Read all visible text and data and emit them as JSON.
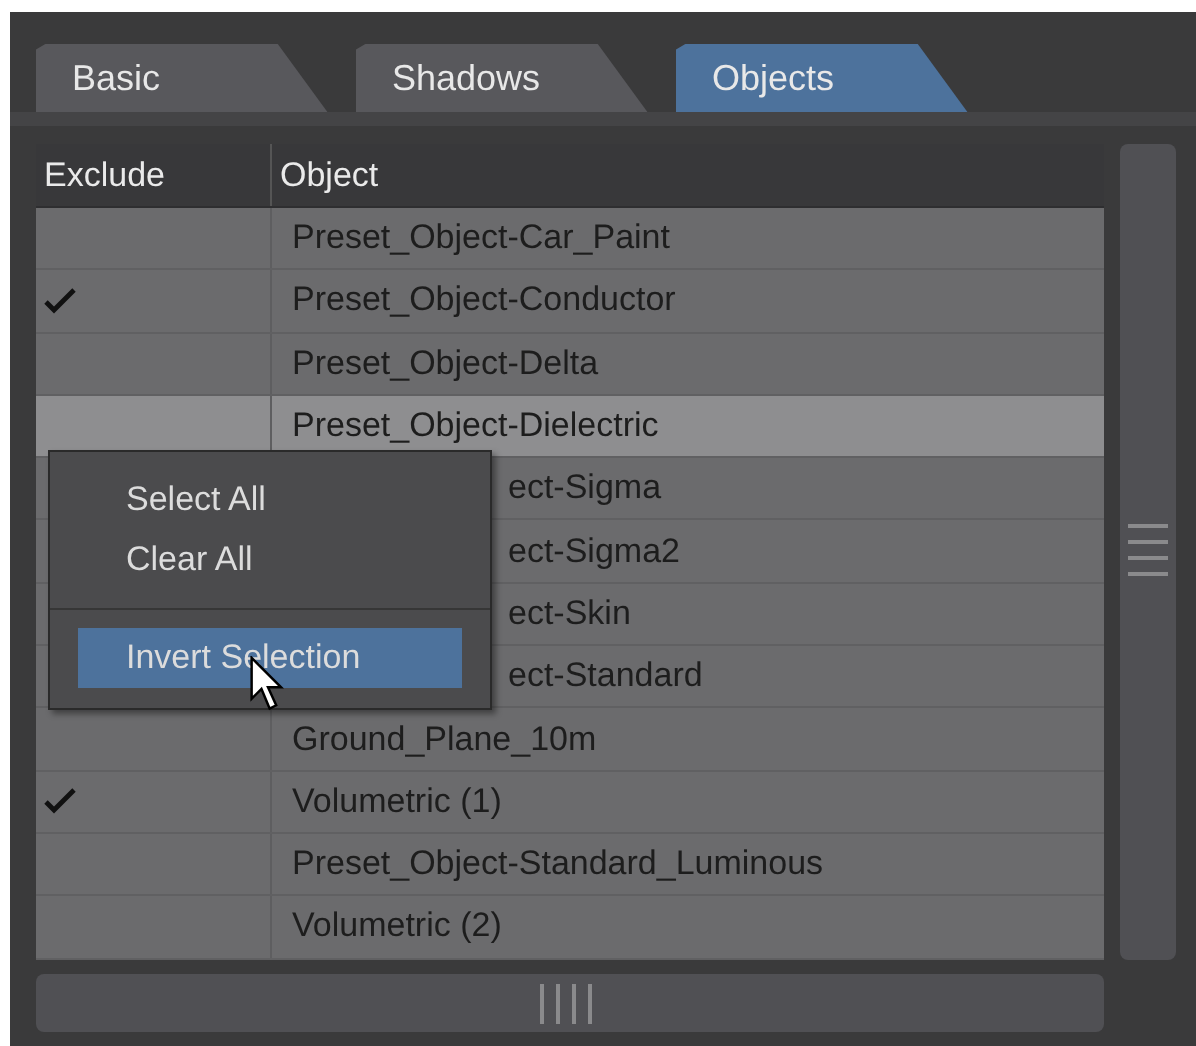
{
  "tabs": [
    {
      "label": "Basic",
      "selected": false
    },
    {
      "label": "Shadows",
      "selected": false
    },
    {
      "label": "Objects",
      "selected": true
    }
  ],
  "table": {
    "columns": [
      "Exclude",
      "Object"
    ],
    "rows": [
      {
        "object": "Preset_Object-Car_Paint",
        "checked": false,
        "selected": false,
        "covered": false
      },
      {
        "object": "Preset_Object-Conductor",
        "checked": true,
        "selected": false,
        "covered": false
      },
      {
        "object": "Preset_Object-Delta",
        "checked": false,
        "selected": false,
        "covered": false
      },
      {
        "object": "Preset_Object-Dielectric",
        "checked": false,
        "selected": true,
        "covered": false
      },
      {
        "object": "ect-Sigma",
        "selected": false,
        "covered": true
      },
      {
        "object": "ect-Sigma2",
        "selected": false,
        "covered": true
      },
      {
        "object": "ect-Skin",
        "selected": false,
        "covered": true
      },
      {
        "object": "ect-Standard",
        "selected": false,
        "covered": true
      },
      {
        "object": "Ground_Plane_10m",
        "checked": false,
        "selected": false,
        "covered": false
      },
      {
        "object": "Volumetric (1)",
        "checked": true,
        "selected": false,
        "covered": false
      },
      {
        "object": "Preset_Object-Standard_Luminous",
        "checked": false,
        "selected": false,
        "covered": false
      },
      {
        "object": "Volumetric (2)",
        "checked": false,
        "selected": false,
        "covered": false
      }
    ]
  },
  "context_menu": {
    "items": [
      {
        "label": "Select All",
        "selected": false,
        "kind": "item"
      },
      {
        "label": "Clear All",
        "selected": false,
        "kind": "item"
      },
      {
        "kind": "divider"
      },
      {
        "label": "Invert Selection",
        "selected": true,
        "kind": "item"
      }
    ]
  }
}
